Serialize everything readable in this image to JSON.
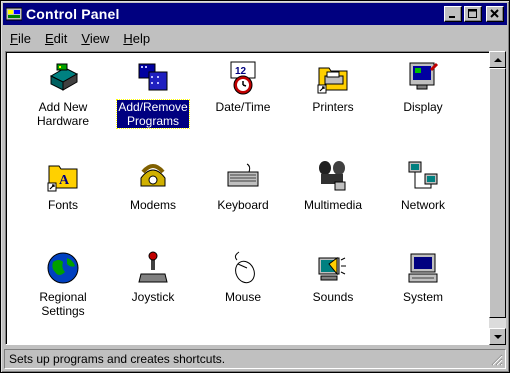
{
  "window": {
    "title": "Control Panel",
    "title_icon": "control-panel-icon",
    "buttons": [
      "minimize-icon",
      "maximize-icon",
      "close-icon"
    ]
  },
  "menu": [
    {
      "label": "File",
      "accel": "F"
    },
    {
      "label": "Edit",
      "accel": "E"
    },
    {
      "label": "View",
      "accel": "V"
    },
    {
      "label": "Help",
      "accel": "H"
    }
  ],
  "items": [
    {
      "label1": "Add New",
      "label2": "Hardware",
      "icon": "add-hardware-icon",
      "selected": false
    },
    {
      "label1": "Add/Remove",
      "label2": "Programs",
      "icon": "add-remove-programs-icon",
      "selected": true
    },
    {
      "label1": "Date/Time",
      "label2": "",
      "icon": "date-time-icon",
      "selected": false
    },
    {
      "label1": "Printers",
      "label2": "",
      "icon": "printers-icon",
      "selected": false
    },
    {
      "label1": "Display",
      "label2": "",
      "icon": "display-icon",
      "selected": false
    },
    {
      "label1": "Fonts",
      "label2": "",
      "icon": "fonts-icon",
      "selected": false
    },
    {
      "label1": "Modems",
      "label2": "",
      "icon": "modems-icon",
      "selected": false
    },
    {
      "label1": "Keyboard",
      "label2": "",
      "icon": "keyboard-icon",
      "selected": false
    },
    {
      "label1": "Multimedia",
      "label2": "",
      "icon": "multimedia-icon",
      "selected": false
    },
    {
      "label1": "Network",
      "label2": "",
      "icon": "network-icon",
      "selected": false
    },
    {
      "label1": "Regional",
      "label2": "Settings",
      "icon": "globe-icon",
      "selected": false
    },
    {
      "label1": "Joystick",
      "label2": "",
      "icon": "joystick-icon",
      "selected": false
    },
    {
      "label1": "Mouse",
      "label2": "",
      "icon": "mouse-icon",
      "selected": false
    },
    {
      "label1": "Sounds",
      "label2": "",
      "icon": "sounds-icon",
      "selected": false
    },
    {
      "label1": "System",
      "label2": "",
      "icon": "system-icon",
      "selected": false
    }
  ],
  "status": {
    "text": "Sets up programs and creates shortcuts."
  },
  "colors": {
    "titlebar": "#000080",
    "face": "#c0c0c0",
    "selection": "#000080"
  }
}
